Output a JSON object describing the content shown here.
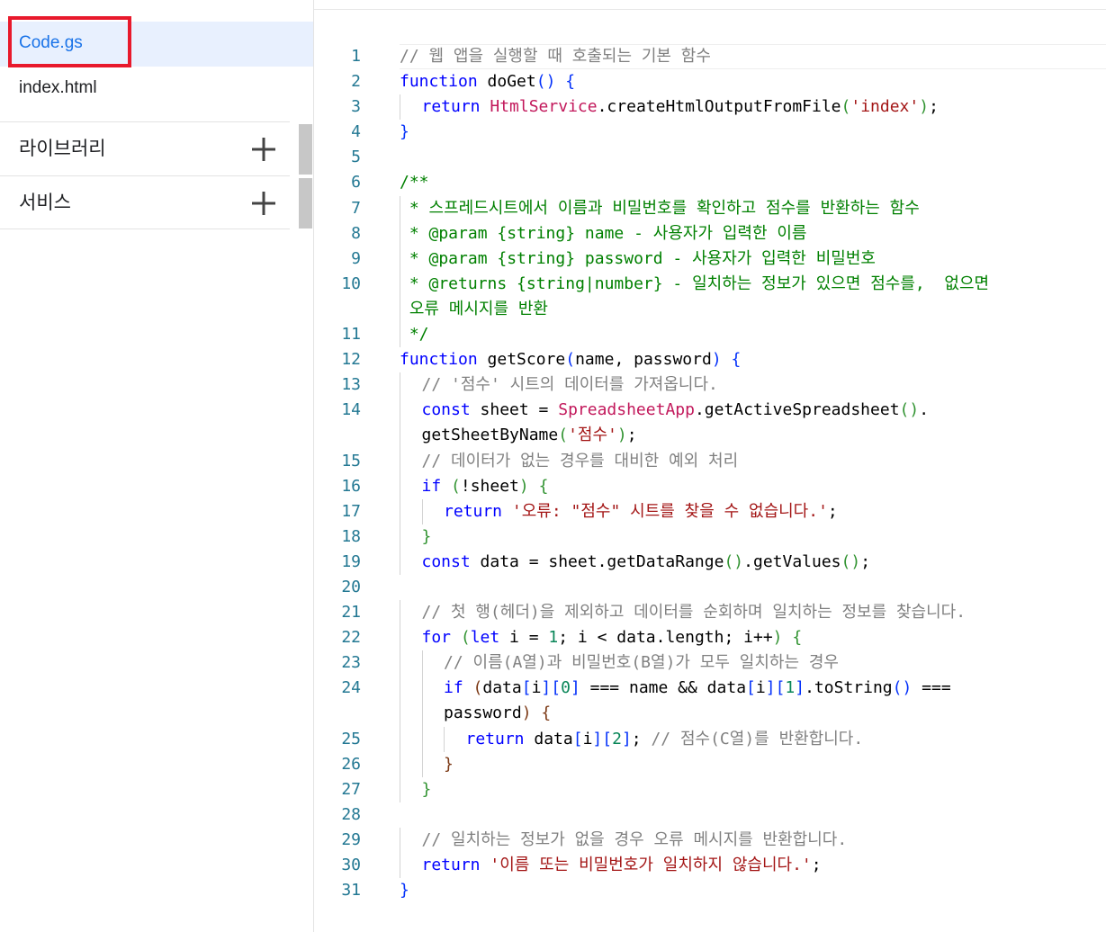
{
  "files": [
    {
      "name": "Code.gs",
      "active": true
    },
    {
      "name": "index.html",
      "active": false
    }
  ],
  "sections": [
    {
      "label": "라이브러리"
    },
    {
      "label": "서비스"
    }
  ],
  "colors": {
    "keyword": "#0000ff",
    "comment": "#008000",
    "string": "#a31515",
    "class": "#c2185b",
    "number": "#098658",
    "line_number": "#237893",
    "highlight_box": "#e8192c",
    "active_file": "#1a73e8"
  },
  "icons": {
    "add": "plus-icon"
  },
  "code_lines": [
    {
      "n": "1",
      "indent": 0,
      "tokens": [
        [
          "cm-gray",
          "// 웹 앱을 실행할 때 호출되는 기본 함수"
        ]
      ]
    },
    {
      "n": "2",
      "indent": 0,
      "tokens": [
        [
          "kw",
          "function"
        ],
        [
          "",
          " doGet"
        ],
        [
          "br1",
          "()"
        ],
        [
          "",
          " "
        ],
        [
          "br1",
          "{"
        ]
      ]
    },
    {
      "n": "3",
      "indent": 1,
      "tokens": [
        [
          "kw",
          "return"
        ],
        [
          "",
          " "
        ],
        [
          "cls",
          "HtmlService"
        ],
        [
          "",
          ".createHtmlOutputFromFile"
        ],
        [
          "br2",
          "("
        ],
        [
          "st",
          "'index'"
        ],
        [
          "br2",
          ")"
        ],
        [
          "",
          ";"
        ]
      ]
    },
    {
      "n": "4",
      "indent": 0,
      "tokens": [
        [
          "br1",
          "}"
        ]
      ]
    },
    {
      "n": "5",
      "indent": 0,
      "tokens": []
    },
    {
      "n": "6",
      "indent": 0,
      "tokens": [
        [
          "cm",
          "/**"
        ]
      ]
    },
    {
      "n": "7",
      "indent": 0,
      "tokens": [
        [
          "cm",
          " * 스프레드시트에서 이름과 비밀번호를 확인하고 점수를 반환하는 함수"
        ]
      ]
    },
    {
      "n": "8",
      "indent": 0,
      "tokens": [
        [
          "cm",
          " * @param {string} name - 사용자가 입력한 이름"
        ]
      ]
    },
    {
      "n": "9",
      "indent": 0,
      "tokens": [
        [
          "cm",
          " * @param {string} password - 사용자가 입력한 비밀번호"
        ]
      ]
    },
    {
      "n": "10",
      "indent": 0,
      "tokens": [
        [
          "cm",
          " * @returns {string|number} - 일치하는 정보가 있으면 점수를,  없으면"
        ]
      ]
    },
    {
      "n": "",
      "indent": 0,
      "tokens": [
        [
          "cm",
          " 오류 메시지를 반환"
        ]
      ]
    },
    {
      "n": "11",
      "indent": 0,
      "tokens": [
        [
          "cm",
          " */"
        ]
      ]
    },
    {
      "n": "12",
      "indent": 0,
      "tokens": [
        [
          "kw",
          "function"
        ],
        [
          "",
          " getScore"
        ],
        [
          "br1",
          "("
        ],
        [
          "",
          "name, password"
        ],
        [
          "br1",
          ")"
        ],
        [
          "",
          " "
        ],
        [
          "br1",
          "{"
        ]
      ]
    },
    {
      "n": "13",
      "indent": 1,
      "tokens": [
        [
          "cm-gray",
          "// '점수' 시트의 데이터를 가져옵니다."
        ]
      ]
    },
    {
      "n": "14",
      "indent": 1,
      "tokens": [
        [
          "kw",
          "const"
        ],
        [
          "",
          " sheet = "
        ],
        [
          "cls",
          "SpreadsheetApp"
        ],
        [
          "",
          ".getActiveSpreadsheet"
        ],
        [
          "br2",
          "()"
        ],
        [
          "",
          "."
        ]
      ]
    },
    {
      "n": "",
      "indent": 1,
      "tokens": [
        [
          "",
          "getSheetByName"
        ],
        [
          "br2",
          "("
        ],
        [
          "st",
          "'점수'"
        ],
        [
          "br2",
          ")"
        ],
        [
          "",
          ";"
        ]
      ]
    },
    {
      "n": "15",
      "indent": 1,
      "tokens": [
        [
          "cm-gray",
          "// 데이터가 없는 경우를 대비한 예외 처리"
        ]
      ]
    },
    {
      "n": "16",
      "indent": 1,
      "tokens": [
        [
          "kw",
          "if"
        ],
        [
          "",
          " "
        ],
        [
          "br2",
          "("
        ],
        [
          "",
          "!sheet"
        ],
        [
          "br2",
          ")"
        ],
        [
          "",
          " "
        ],
        [
          "br2",
          "{"
        ]
      ]
    },
    {
      "n": "17",
      "indent": 2,
      "tokens": [
        [
          "kw",
          "return"
        ],
        [
          "",
          " "
        ],
        [
          "st",
          "'오류: \"점수\" 시트를 찾을 수 없습니다.'"
        ],
        [
          "",
          ";"
        ]
      ]
    },
    {
      "n": "18",
      "indent": 1,
      "tokens": [
        [
          "br2",
          "}"
        ]
      ]
    },
    {
      "n": "19",
      "indent": 1,
      "tokens": [
        [
          "kw",
          "const"
        ],
        [
          "",
          " data = sheet.getDataRange"
        ],
        [
          "br2",
          "()"
        ],
        [
          "",
          ".getValues"
        ],
        [
          "br2",
          "()"
        ],
        [
          "",
          ";"
        ]
      ]
    },
    {
      "n": "20",
      "indent": 0,
      "tokens": []
    },
    {
      "n": "21",
      "indent": 1,
      "tokens": [
        [
          "cm-gray",
          "// 첫 행(헤더)을 제외하고 데이터를 순회하며 일치하는 정보를 찾습니다."
        ]
      ]
    },
    {
      "n": "22",
      "indent": 1,
      "tokens": [
        [
          "kw",
          "for"
        ],
        [
          "",
          " "
        ],
        [
          "br2",
          "("
        ],
        [
          "kw",
          "let"
        ],
        [
          "",
          " i = "
        ],
        [
          "num",
          "1"
        ],
        [
          "",
          "; i < data.length; i++"
        ],
        [
          "br2",
          ")"
        ],
        [
          "",
          " "
        ],
        [
          "br2",
          "{"
        ]
      ]
    },
    {
      "n": "23",
      "indent": 2,
      "tokens": [
        [
          "cm-gray",
          "// 이름(A열)과 비밀번호(B열)가 모두 일치하는 경우"
        ]
      ]
    },
    {
      "n": "24",
      "indent": 2,
      "tokens": [
        [
          "kw",
          "if"
        ],
        [
          "",
          " "
        ],
        [
          "br3",
          "("
        ],
        [
          "",
          "data"
        ],
        [
          "br1",
          "["
        ],
        [
          "",
          "i"
        ],
        [
          "br1",
          "]"
        ],
        [
          "br1",
          "["
        ],
        [
          "num",
          "0"
        ],
        [
          "br1",
          "]"
        ],
        [
          "",
          " === name && data"
        ],
        [
          "br1",
          "["
        ],
        [
          "",
          "i"
        ],
        [
          "br1",
          "]"
        ],
        [
          "br1",
          "["
        ],
        [
          "num",
          "1"
        ],
        [
          "br1",
          "]"
        ],
        [
          "",
          ".toString"
        ],
        [
          "br1",
          "()"
        ],
        [
          "",
          " ==="
        ]
      ]
    },
    {
      "n": "",
      "indent": 2,
      "tokens": [
        [
          "",
          "password"
        ],
        [
          "br3",
          ")"
        ],
        [
          "",
          " "
        ],
        [
          "br3",
          "{"
        ]
      ]
    },
    {
      "n": "25",
      "indent": 3,
      "tokens": [
        [
          "kw",
          "return"
        ],
        [
          "",
          " data"
        ],
        [
          "br1",
          "["
        ],
        [
          "",
          "i"
        ],
        [
          "br1",
          "]"
        ],
        [
          "br1",
          "["
        ],
        [
          "num",
          "2"
        ],
        [
          "br1",
          "]"
        ],
        [
          "",
          "; "
        ],
        [
          "cm-gray",
          "// 점수(C열)를 반환합니다."
        ]
      ]
    },
    {
      "n": "26",
      "indent": 2,
      "tokens": [
        [
          "br3",
          "}"
        ]
      ]
    },
    {
      "n": "27",
      "indent": 1,
      "tokens": [
        [
          "br2",
          "}"
        ]
      ]
    },
    {
      "n": "28",
      "indent": 0,
      "tokens": []
    },
    {
      "n": "29",
      "indent": 1,
      "tokens": [
        [
          "cm-gray",
          "// 일치하는 정보가 없을 경우 오류 메시지를 반환합니다."
        ]
      ]
    },
    {
      "n": "30",
      "indent": 1,
      "tokens": [
        [
          "kw",
          "return"
        ],
        [
          "",
          " "
        ],
        [
          "st",
          "'이름 또는 비밀번호가 일치하지 않습니다.'"
        ],
        [
          "",
          ";"
        ]
      ]
    },
    {
      "n": "31",
      "indent": 0,
      "tokens": [
        [
          "br1",
          "}"
        ]
      ]
    }
  ]
}
